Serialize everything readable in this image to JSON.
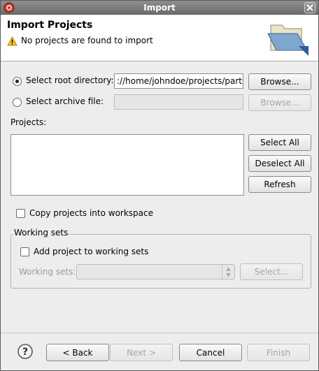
{
  "window": {
    "title": "Import"
  },
  "header": {
    "title": "Import Projects",
    "message": "No projects are found to import"
  },
  "source": {
    "root_dir_label": "Select root directory:",
    "root_dir_value": "://home/johndoe/projects/parts",
    "archive_label": "Select archive file:",
    "archive_value": "",
    "browse_label": "Browse...",
    "browse_archive_label": "Browse..."
  },
  "projects": {
    "label": "Projects:",
    "select_all": "Select All",
    "deselect_all": "Deselect All",
    "refresh": "Refresh"
  },
  "copy_option": {
    "label": "Copy projects into workspace"
  },
  "working_sets": {
    "group_label": "Working sets",
    "add_label": "Add project to working sets",
    "sets_label": "Working sets:",
    "select_label": "Select..."
  },
  "footer": {
    "back": "< Back",
    "next": "Next >",
    "cancel": "Cancel",
    "finish": "Finish"
  }
}
